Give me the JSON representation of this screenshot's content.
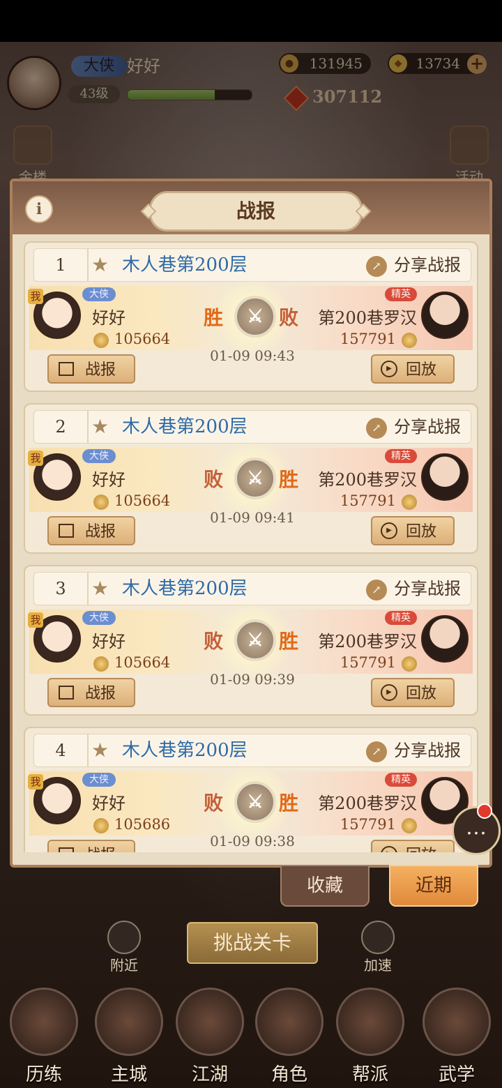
{
  "hud": {
    "title": "大侠",
    "name": "好好",
    "level": "43级",
    "exp_progress": 0.7,
    "silver": "131945",
    "gold": "13734",
    "power": "307112"
  },
  "side_buttons": {
    "left": "金楼",
    "right": "活动"
  },
  "panel": {
    "title": "战报"
  },
  "records": [
    {
      "index": "1",
      "stage": "木人巷第200层",
      "share": "分享战报",
      "player": {
        "title": "大侠",
        "name": "好好",
        "power": "105664",
        "me": "我",
        "result": "胜"
      },
      "opponent": {
        "tag": "精英",
        "name": "第200巷罗汉",
        "power": "157791",
        "result": "败"
      },
      "time": "01-09 09:43",
      "report": "战报",
      "replay": "回放"
    },
    {
      "index": "2",
      "stage": "木人巷第200层",
      "share": "分享战报",
      "player": {
        "title": "大侠",
        "name": "好好",
        "power": "105664",
        "me": "我",
        "result": "败"
      },
      "opponent": {
        "tag": "精英",
        "name": "第200巷罗汉",
        "power": "157791",
        "result": "胜"
      },
      "time": "01-09 09:41",
      "report": "战报",
      "replay": "回放"
    },
    {
      "index": "3",
      "stage": "木人巷第200层",
      "share": "分享战报",
      "player": {
        "title": "大侠",
        "name": "好好",
        "power": "105664",
        "me": "我",
        "result": "败"
      },
      "opponent": {
        "tag": "精英",
        "name": "第200巷罗汉",
        "power": "157791",
        "result": "胜"
      },
      "time": "01-09 09:39",
      "report": "战报",
      "replay": "回放"
    },
    {
      "index": "4",
      "stage": "木人巷第200层",
      "share": "分享战报",
      "player": {
        "title": "大侠",
        "name": "好好",
        "power": "105686",
        "me": "我",
        "result": "败"
      },
      "opponent": {
        "tag": "精英",
        "name": "第200巷罗汉",
        "power": "157791",
        "result": "胜"
      },
      "time": "01-09 09:38",
      "report": "战报",
      "replay": "回放"
    }
  ],
  "tabs": {
    "favorites": "收藏",
    "recent": "近期"
  },
  "challenge": "挑战关卡",
  "mini": {
    "nearby": "附近",
    "speed": "加速"
  },
  "nav": [
    "历练",
    "主城",
    "江湖",
    "角色",
    "帮派",
    "武学"
  ],
  "colors": {
    "win": "#e06a1a",
    "lose": "#c4603a",
    "stage": "#2e6aa8"
  }
}
